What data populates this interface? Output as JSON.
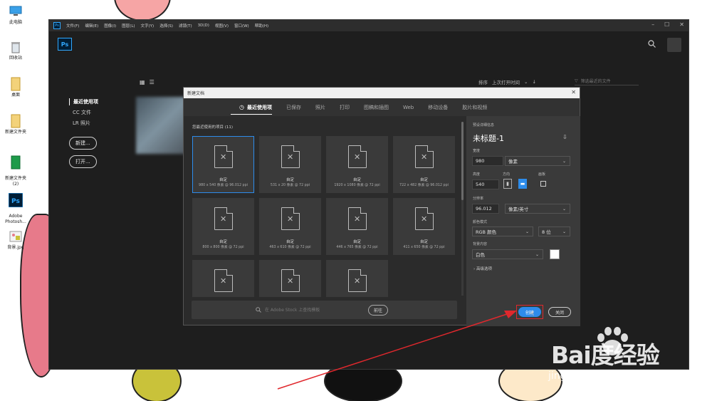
{
  "desktop": {
    "icons": [
      {
        "label": "此电脑",
        "icon": "computer-icon"
      },
      {
        "label": "回收站",
        "icon": "recycle-bin-icon"
      },
      {
        "label": "桌面",
        "icon": "folder-icon"
      },
      {
        "label": "新建文件夹",
        "icon": "folder-icon"
      },
      {
        "label": "新建文件夹\n(2)",
        "icon": "folder-icon"
      },
      {
        "label": "Adobe\nPhotosh...",
        "icon": "photoshop-icon"
      },
      {
        "label": "背景.jpg",
        "icon": "image-file-icon"
      }
    ]
  },
  "menubar": {
    "app_icon": "Ps",
    "items": [
      "文件(F)",
      "编辑(E)",
      "图像(I)",
      "图层(L)",
      "文字(Y)",
      "选择(S)",
      "滤镜(T)",
      "3D(D)",
      "视图(V)",
      "窗口(W)",
      "帮助(H)"
    ],
    "window_controls": [
      "–",
      "☐",
      "✕"
    ]
  },
  "home": {
    "logo": "Ps",
    "sidebar": {
      "items": [
        "最近使用项",
        "CC 文件",
        "LR 照片"
      ],
      "new_button": "新建...",
      "open_button": "打开..."
    },
    "sort_label": "排序",
    "sort_value": "上次打开时间",
    "filter_placeholder": "筛选最近的文件"
  },
  "dialog": {
    "title": "新建文档",
    "tabs": [
      "最近使用项",
      "已保存",
      "照片",
      "打印",
      "图稿和插图",
      "Web",
      "移动设备",
      "胶片和视频"
    ],
    "recent_label": "您最近使用的项目 (11)",
    "presets": [
      {
        "name": "自定",
        "desc": "980 x 540 像素 @ 96.012 ppi"
      },
      {
        "name": "自定",
        "desc": "531 x 20 像素 @ 72 ppi"
      },
      {
        "name": "自定",
        "desc": "1920 x 1080 像素 @ 72 ppi"
      },
      {
        "name": "自定",
        "desc": "722 x 482 像素 @ 96.012 ppi"
      },
      {
        "name": "自定",
        "desc": "800 x 800 像素 @ 72 ppi"
      },
      {
        "name": "自定",
        "desc": "463 x 610 像素 @ 72 ppi"
      },
      {
        "name": "自定",
        "desc": "446 x 765 像素 @ 72 ppi"
      },
      {
        "name": "自定",
        "desc": "411 x 650 像素 @ 72 ppi"
      },
      {
        "name": "",
        "desc": ""
      },
      {
        "name": "",
        "desc": ""
      },
      {
        "name": "",
        "desc": ""
      }
    ],
    "stock_placeholder": "在 Adobe Stock 上查找模板",
    "stock_go": "前往",
    "details": {
      "section_label": "预设详细信息",
      "doc_title": "未标题-1",
      "width_label": "宽度",
      "width_value": "980",
      "width_unit": "像素",
      "height_label": "高度",
      "height_value": "540",
      "orientation_label": "方向",
      "artboard_label": "画板",
      "resolution_label": "分辨率",
      "resolution_value": "96.012",
      "resolution_unit": "像素/英寸",
      "color_mode_label": "颜色模式",
      "color_mode": "RGB 颜色",
      "bit_depth": "8 位",
      "bg_label": "背景内容",
      "bg_value": "白色",
      "advanced_label": "高级选项",
      "create_button": "创建",
      "close_button": "关闭"
    }
  },
  "watermark": {
    "brand": "Bai度经验",
    "url": "jingyan.baidu.com"
  },
  "colors": {
    "accent": "#2d8ceb",
    "annotation": "#e0282d",
    "ps_blue": "#31a8ff"
  }
}
